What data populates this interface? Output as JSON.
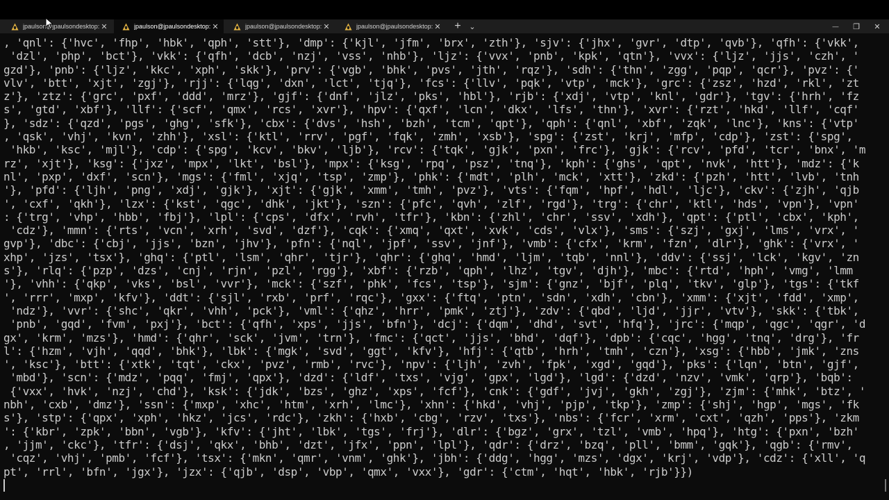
{
  "tabs": [
    {
      "title": "jpaulson@jpaulsondesktop: /m",
      "icon": "linux-penguin-icon",
      "active": false
    },
    {
      "title": "jpaulson@jpaulsondesktop: /m",
      "icon": "linux-penguin-icon",
      "active": true
    },
    {
      "title": "jpaulson@jpaulsondesktop: /m",
      "icon": "linux-penguin-icon",
      "active": false
    },
    {
      "title": "jpaulson@jpaulsondesktop: /m",
      "icon": "linux-penguin-icon",
      "active": false
    }
  ],
  "controls": {
    "close_glyph": "✕",
    "new_tab": "+",
    "dropdown": "⌄",
    "minimize": "—",
    "restore": "❐",
    "window_close": "✕"
  },
  "terminal": {
    "lines": [
      ", 'qnl': {'hvc', 'fhp', 'hbk', 'qph', 'stt'}, 'dmp': {'kjl', 'jfm', 'brx', 'zth'}, 'sjv': {'jhx', 'gvr', 'dtp', 'qvb'}, 'qfh': {'vkk',",
      " 'dzl', 'php', 'bct'}, 'vkk': {'qfh', 'dcb', 'nzj', 'vss', 'nhb'}, 'ljz': {'vvx', 'pnb', 'kpk', 'qtn'}, 'vvx': {'ljz', 'jjs', 'czh', '",
      "gzd'}, 'pnb': {'ljz', 'kkc', 'xph', 'skk'}, 'prv': {'vgb', 'bhk', 'pvs', 'jth', 'rqz'}, 'sdh': {'thn', 'zgg', 'pqp', 'qcr'}, 'pvz': {'",
      "vlv', 'btt', 'xjt', 'zgj'}, 'rjj': {'lqg', 'dxn', 'lct', 'tjq'}, 'fcs': {'llv', 'pqk', 'vtp', 'mck'}, 'grc': {'zsz', 'hzd', 'rkl', 'zt",
      "z'}, 'ztz': {'grc', 'pxf', 'ddd', 'mrz'}, 'gjf': {'dnf', 'jlz', 'pks', 'hbl'}, 'rjb': {'xdj', 'vtp', 'knl', 'gdr'}, 'tgv': {'hrh', 'fz",
      "s', 'gtd', 'xbf'}, 'llf': {'scf', 'qmx', 'rcs', 'xvr'}, 'hpv': {'qxf', 'lcn', 'dkx', 'lfs', 'thn'}, 'xvr': {'rzt', 'hkd', 'llf', 'cqf'",
      "}, 'sdz': {'qzd', 'pgs', 'ghg', 'sfk'}, 'cbx': {'dvs', 'hsh', 'bzh', 'tcm', 'qpt'}, 'qph': {'qnl', 'xbf', 'zqk', 'lnc'}, 'kns': {'vtp'",
      ", 'qsk', 'vhj', 'kvn', 'zhh'}, 'xsl': {'ktl', 'rrv', 'pgf', 'fqk', 'zmh', 'xsb'}, 'spg': {'zst', 'krj', 'mfp', 'cdp'}, 'zst': {'spg',",
      " 'hkb', 'ksc', 'mjl'}, 'cdp': {'spg', 'kcv', 'bkv', 'ljb'}, 'rcv': {'tqk', 'gjk', 'pxn', 'frc'}, 'gjk': {'rcv', 'pfd', 'tcr', 'bnx', 'm",
      "rz', 'xjt'}, 'ksg': {'jxz', 'mpx', 'lkt', 'bsl'}, 'mpx': {'ksg', 'rpq', 'psz', 'tnq'}, 'kph': {'ghs', 'qpt', 'nvk', 'htt'}, 'mdz': {'k",
      "nl', 'pxp', 'dxf', 'scn'}, 'mgs': {'fml', 'xjq', 'tsp', 'zmp'}, 'phk': {'mdt', 'plh', 'mck', 'xtt'}, 'zkd': {'pzh', 'htt', 'lvb', 'tnh",
      "'}, 'pfd': {'ljh', 'png', 'xdj', 'gjk'}, 'xjt': {'gjk', 'xmm', 'tmh', 'pvz'}, 'vts': {'fqm', 'hpf', 'hdl', 'ljc'}, 'ckv': {'zjh', 'qjb",
      "', 'cxf', 'qkh'}, 'lzx': {'kst', 'qgc', 'dhk', 'jkt'}, 'szn': {'pfc', 'qvh', 'zlf', 'rgd'}, 'trg': {'chr', 'ktl', 'hds', 'vpn'}, 'vpn'",
      ": {'trg', 'vhp', 'hbb', 'fbj'}, 'lpl': {'cps', 'dfx', 'rvh', 'tfr'}, 'kbn': {'zhl', 'chr', 'ssv', 'xdh'}, 'qpt': {'ptl', 'cbx', 'kph',",
      " 'cdz'}, 'mmn': {'rts', 'vcn', 'xrh', 'svd', 'dzf'}, 'cqk': {'xmq', 'qxt', 'xvk', 'cds', 'vlx'}, 'sms': {'szj', 'gxj', 'lms', 'vrx', '",
      "gvp'}, 'dbc': {'cbj', 'jjs', 'bzn', 'jhv'}, 'pfn': {'nql', 'jpf', 'ssv', 'jnf'}, 'vmb': {'cfx', 'krm', 'fzn', 'dlr'}, 'ghk': {'vrx', '",
      "xhp', 'jzs', 'tsx'}, 'ghq': {'ptl', 'lsm', 'qhr', 'tjr'}, 'qhr': {'ghq', 'hmd', 'ljm', 'tqb', 'nnl'}, 'ddv': {'ssj', 'lck', 'kgv', 'zn",
      "s'}, 'rlq': {'pzp', 'dzs', 'cnj', 'rjn', 'pzl', 'rgg'}, 'xbf': {'rzb', 'qph', 'lhz', 'tgv', 'djh'}, 'mbc': {'rtd', 'hph', 'vmg', 'lmm",
      "'}, 'vhh': {'qkp', 'vks', 'bsl', 'vvr'}, 'mck': {'szf', 'phk', 'fcs', 'tsp'}, 'sjm': {'gnz', 'bjf', 'plq', 'tkv', 'glp'}, 'tgs': {'tkf",
      "', 'rrr', 'mxp', 'kfv'}, 'ddt': {'sjl', 'rxb', 'prf', 'rqc'}, 'gxx': {'ftq', 'ptn', 'sdn', 'xdh', 'cbn'}, 'xmm': {'xjt', 'fdd', 'xmp',",
      " 'ndz'}, 'vvr': {'shc', 'qkr', 'vhh', 'pck'}, 'vml': {'qhz', 'hrr', 'pmk', 'ztj'}, 'zdv': {'qbd', 'ljd', 'jjr', 'vtv'}, 'skk': {'tbk',",
      " 'pnb', 'gqd', 'fvm', 'pxj'}, 'bct': {'qfh', 'xps', 'jjs', 'bfn'}, 'dcj': {'dqm', 'dhd', 'svt', 'hfq'}, 'jrc': {'mqp', 'qgc', 'qgr', 'd",
      "gx', 'krm', 'mzs'}, 'hmd': {'qhr', 'sck', 'jvm', 'trn'}, 'fmc': {'qct', 'jjs', 'bhd', 'dqf'}, 'dpb': {'cqc', 'hgg', 'tnq', 'drg'}, 'fr",
      "l': {'hzm', 'vjh', 'qqd', 'bhk'}, 'lbk': {'mgk', 'svd', 'ggt', 'kfv'}, 'hfj': {'qtb', 'hrh', 'tmh', 'czn'}, 'xsg': {'hbb', 'jmk', 'zns",
      "', 'ksc'}, 'btt': {'xtk', 'tqt', 'ckx', 'pvz', 'rmb', 'rvc'}, 'npv': {'ljh', 'zvh', 'fpk', 'xgd', 'gqd'}, 'pks': {'lqn', 'btn', 'gjf',",
      " 'mbd'}, 'scn': {'mdz', 'pqq', 'fmj', 'qpx'}, 'dzd': {'ldf', 'txs', 'vjg', 'gpx', 'lgd'}, 'lgd': {'dzd', 'nzv', 'vmk', 'qrp'}, 'bqb':",
      " {'vxx', 'hvk', 'nzj', 'chd'}, 'ksk': {'jdk', 'bzs', 'ghz', 'xps', 'fcf'}, 'cnk': {'gdf', 'jvj', 'gkh', 'zgj'}, 'zjm': {'mhk', 'btz', '",
      "nbh', 'cxb', 'dmz'}, 'ssn': {'mxp', 'xhc', 'htm', 'xrh', 'lmc'}, 'xhn': {'hkd', 'vhj', 'pjp', 'tkp'}, 'zmp': {'shj', 'hgp', 'mgs', 'fk",
      "s'}, 'stp': {'qpx', 'xph', 'hkz', 'jcs', 'rdc'}, 'zkh': {'hxb', 'cbg', 'rzv', 'txs'}, 'nbs': {'fcr', 'xrm', 'cxt', 'qzh', 'pps'}, 'zkm",
      "': {'kbr', 'zpk', 'bbn', 'vgb'}, 'kfv': {'jht', 'lbk', 'tgs', 'frj'}, 'dlr': {'bgz', 'grx', 'tzl', 'vmb', 'hpq'}, 'htg': {'pxn', 'bzh'",
      ", 'jjm', 'ckc'}, 'tfr': {'dsj', 'qkx', 'bhb', 'dzt', 'jfx', 'ppn', 'lpl'}, 'qdr': {'drz', 'bzq', 'pll', 'bmm', 'gqk'}, 'qgb': {'rmv',",
      " 'cqz', 'vhj', 'pmb', 'fcf'}, 'tsx': {'mkn', 'qmr', 'vnm', 'ghk'}, 'jbh': {'ddg', 'hgg', 'mzs', 'dgx', 'krj', 'vdp'}, 'cdz': {'xll', 'q",
      "pt', 'rrl', 'bfn', 'jgx'}, 'jzx': {'qjb', 'dsp', 'vbp', 'qmx', 'vxx'}, 'gdr': {'ctm', 'hqt', 'hbk', 'rjb'}})"
    ]
  }
}
